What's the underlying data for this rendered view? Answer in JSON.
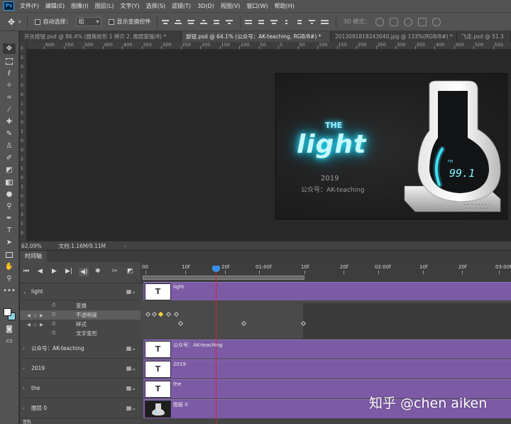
{
  "menubar": {
    "logo": "Ps",
    "items": [
      "文件(F)",
      "编辑(E)",
      "图像(I)",
      "图层(L)",
      "文字(Y)",
      "选择(S)",
      "滤镜(T)",
      "3D(D)",
      "视图(V)",
      "窗口(W)",
      "帮助(H)"
    ]
  },
  "options": {
    "auto_select_label": "自动选择：",
    "auto_select_value": "组",
    "show_transform_label": "显示变换控件",
    "mode_3d_label": "3D 模式："
  },
  "tabs": [
    "开关按钮.psd @ 86.4% (圆角矩形 1 拷贝 2, 图层蒙版/8) *",
    "旋钮.psd @ 64.1% (公众号：AK-teaching, RGB/8#) *",
    "20130918182430­40.jpg @ 133%(RGB/8#) *",
    "飞走.psd @ 51.3"
  ],
  "ruler": {
    "h_labels": [
      "600",
      "550",
      "500",
      "450",
      "400",
      "350",
      "300",
      "250",
      "200",
      "150",
      "100",
      "50",
      "0",
      "50",
      "100",
      "150",
      "200",
      "250",
      "300",
      "350",
      "400",
      "450",
      "500",
      "550",
      "600",
      "650",
      "700",
      "750"
    ],
    "v_labels": [
      "0",
      "5",
      "0",
      "1",
      "0",
      "0",
      "1",
      "5",
      "0",
      "2",
      "0",
      "0",
      "2",
      "5",
      "0",
      "3",
      "0",
      "0",
      "3",
      "5",
      "0"
    ]
  },
  "artwork": {
    "the": "THE",
    "light": "light",
    "year": "2019",
    "subtitle": "公众号：AK-teaching",
    "display_small": "FM",
    "display_value": "99.1"
  },
  "status": {
    "zoom": "62.09%",
    "doc": "文档:1.16M/9.11M",
    "arrow": "›"
  },
  "timeline": {
    "panel_title": "时间轴",
    "ruler_labels": [
      "00",
      "10f",
      "20f",
      "01:00f",
      "10f",
      "20f",
      "02:00f",
      "10f",
      "20f",
      "03:00f"
    ],
    "layers": [
      {
        "name": "light",
        "clip": "light"
      },
      {
        "name": "公众号：AK-teaching",
        "clip": "公众号：AK-teaching"
      },
      {
        "name": "2019",
        "clip": "2019"
      },
      {
        "name": "the",
        "clip": "the"
      },
      {
        "name": "图层 0",
        "clip": "图层 0"
      }
    ],
    "properties": [
      "变换",
      "不透明度",
      "样式",
      "文字变形"
    ],
    "footer": "音轨",
    "thumb_text": "T"
  },
  "watermark": "知乎 @chen aiken",
  "colors": {
    "clip": "#7c5aa5",
    "playhead": "#d1252f",
    "glow": "#2de7ff"
  }
}
